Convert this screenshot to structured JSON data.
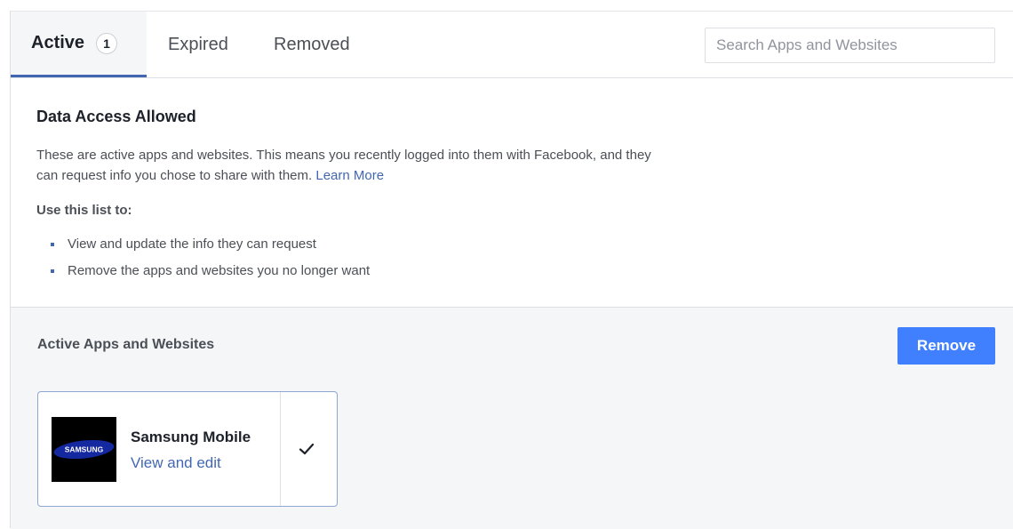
{
  "tabs": {
    "active": {
      "label": "Active",
      "count": "1"
    },
    "expired": {
      "label": "Expired"
    },
    "removed": {
      "label": "Removed"
    }
  },
  "search": {
    "placeholder": "Search Apps and Websites",
    "value": ""
  },
  "info": {
    "title": "Data Access Allowed",
    "description": "These are active apps and websites. This means you recently logged into them with Facebook, and they can request info you chose to share with them.",
    "learn_more": "Learn More",
    "use_title": "Use this list to:",
    "bullets": [
      "View and update the info they can request",
      "Remove the apps and websites you no longer want"
    ]
  },
  "apps_section": {
    "title": "Active Apps and Websites",
    "remove_label": "Remove",
    "apps": [
      {
        "name": "Samsung Mobile",
        "link": "View and edit",
        "logo_text": "SAMSUNG",
        "checked": true,
        "logo_color": "#1428a0"
      }
    ]
  },
  "colors": {
    "accent": "#4267b2",
    "button": "#4080ff",
    "section_bg": "#f5f6f7"
  }
}
